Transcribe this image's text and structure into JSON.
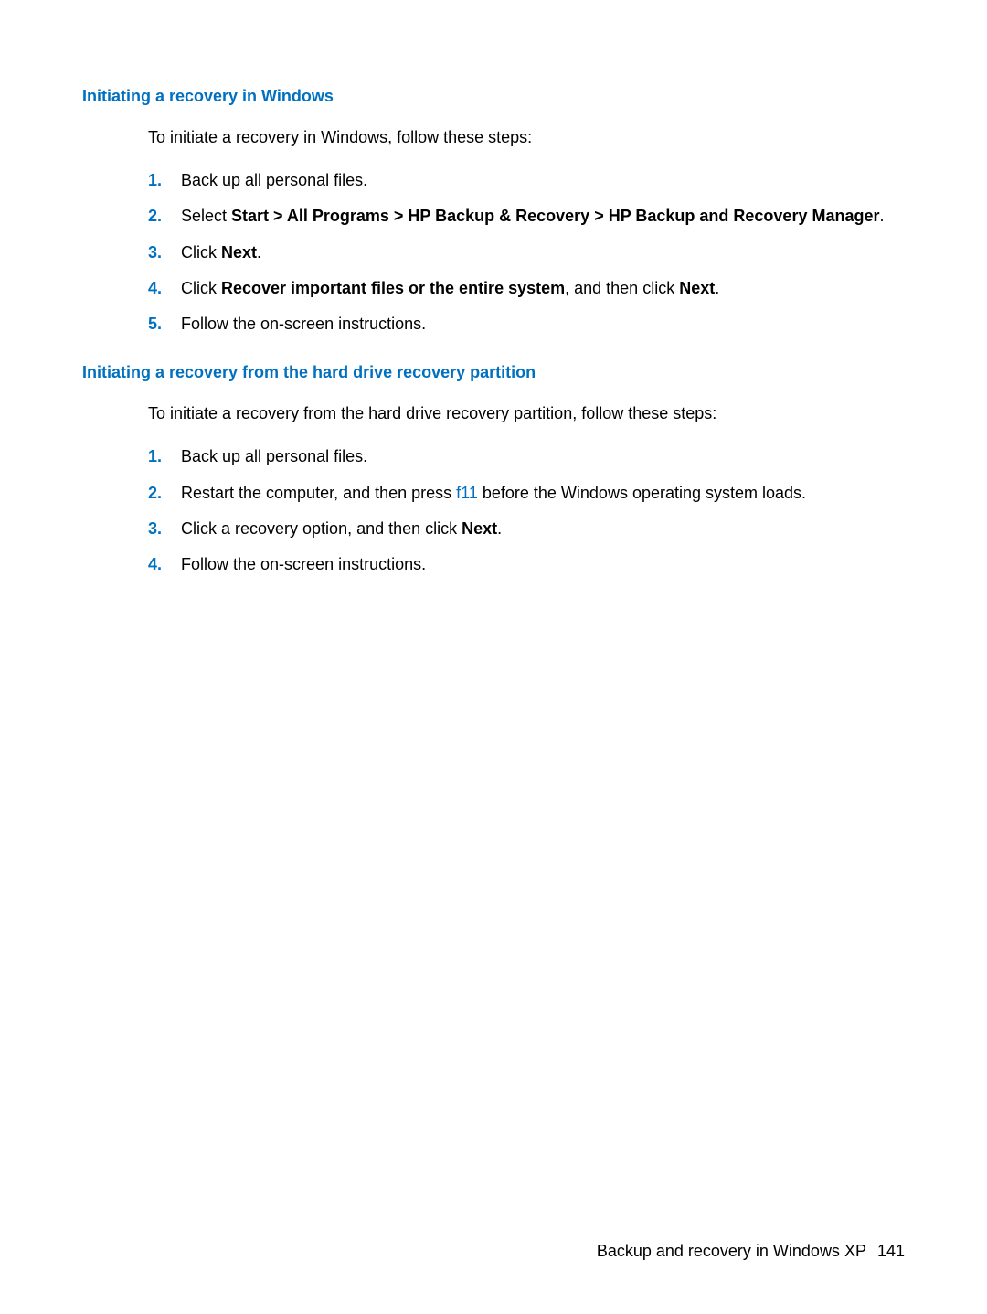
{
  "section1": {
    "heading": "Initiating a recovery in Windows",
    "intro": "To initiate a recovery in Windows, follow these steps:",
    "steps": [
      {
        "num": "1.",
        "text": "Back up all personal files."
      },
      {
        "num": "2.",
        "prefix": "Select ",
        "bold": "Start > All Programs > HP Backup & Recovery > HP Backup and Recovery Manager",
        "suffix": "."
      },
      {
        "num": "3.",
        "prefix": "Click ",
        "bold": "Next",
        "suffix": "."
      },
      {
        "num": "4.",
        "prefix": "Click ",
        "bold": "Recover important files or the entire system",
        "middle": ", and then click ",
        "bold2": "Next",
        "suffix": "."
      },
      {
        "num": "5.",
        "text": "Follow the on-screen instructions."
      }
    ]
  },
  "section2": {
    "heading": "Initiating a recovery from the hard drive recovery partition",
    "intro": "To initiate a recovery from the hard drive recovery partition, follow these steps:",
    "steps": [
      {
        "num": "1.",
        "text": "Back up all personal files."
      },
      {
        "num": "2.",
        "prefix": "Restart the computer, and then press ",
        "key": "f11",
        "suffix": " before the Windows operating system loads."
      },
      {
        "num": "3.",
        "prefix": "Click a recovery option, and then click ",
        "bold": "Next",
        "suffix": "."
      },
      {
        "num": "4.",
        "text": "Follow the on-screen instructions."
      }
    ]
  },
  "footer": {
    "text": "Backup and recovery in Windows XP",
    "page": "141"
  }
}
